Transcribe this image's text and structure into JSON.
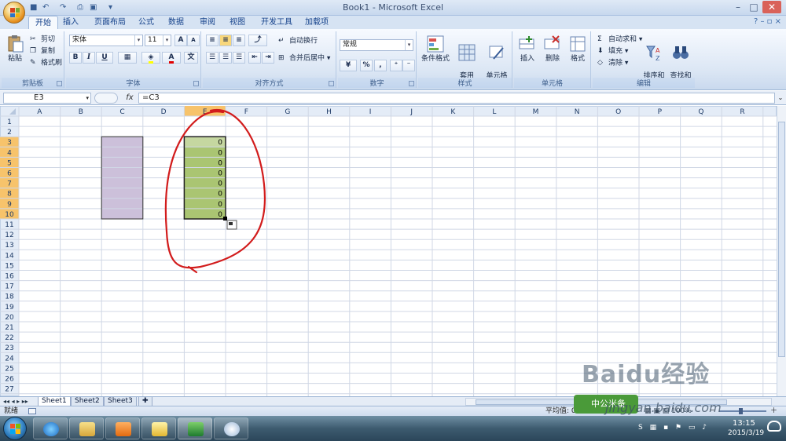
{
  "window": {
    "title": "Book1 - Microsoft Excel",
    "minimize": "–",
    "maximize": "□",
    "close": "✕"
  },
  "qat": {
    "save": "■",
    "undo": "↶",
    "redo": "↷",
    "print": "⎙",
    "preview": "▣",
    "more": "▾"
  },
  "tabs": [
    "开始",
    "插入",
    "页面布局",
    "公式",
    "数据",
    "审阅",
    "视图",
    "开发工具",
    "加载项"
  ],
  "ribbon": {
    "clipboard": {
      "label": "剪贴板",
      "paste": "粘贴",
      "cut": "剪切",
      "copy": "复制",
      "format_painter": "格式刷"
    },
    "font": {
      "label": "字体",
      "name": "宋体",
      "size": "11",
      "bold": "B",
      "italic": "I",
      "underline": "U",
      "grow": "A",
      "shrink": "A",
      "fill_label": "A"
    },
    "alignment": {
      "label": "对齐方式",
      "wrap": "自动换行",
      "merge": "合并后居中"
    },
    "number": {
      "label": "数字",
      "format": "常规",
      "percent": "%",
      "comma": ","
    },
    "styles": {
      "label": "样式",
      "conditional": "条件格式",
      "table": "套用\n表格格式",
      "cell_styles": "单元格\n样式"
    },
    "cells": {
      "label": "单元格",
      "insert": "插入",
      "delete": "删除",
      "format": "格式"
    },
    "editing": {
      "label": "编辑",
      "autosum": "自动求和",
      "fill": "填充",
      "clear": "清除",
      "sort": "排序和\n筛选",
      "find": "查找和\n选择"
    }
  },
  "formula_bar": {
    "name_box": "E3",
    "fx": "fx",
    "formula": "=C3"
  },
  "columns": [
    "A",
    "B",
    "C",
    "D",
    "E",
    "F",
    "G",
    "H",
    "I",
    "J",
    "K",
    "L",
    "M",
    "N",
    "O",
    "P",
    "Q",
    "R"
  ],
  "rows": [
    "1",
    "2",
    "3",
    "4",
    "5",
    "6",
    "7",
    "8",
    "9",
    "10",
    "11",
    "12",
    "13",
    "14",
    "15",
    "16",
    "17",
    "18",
    "19",
    "20",
    "21",
    "22",
    "23",
    "24",
    "25",
    "26",
    "27"
  ],
  "cells": {
    "E3": "0",
    "E4": "0",
    "E5": "0",
    "E6": "0",
    "E7": "0",
    "E8": "0",
    "E9": "0",
    "E10": "0"
  },
  "colors": {
    "purple_fill": "#ccc0da",
    "green_fill": "#9bbb59",
    "annotation": "#d21c1c",
    "selected_header": "#f7c36b"
  },
  "sheets": [
    "Sheet1",
    "Sheet2",
    "Sheet3"
  ],
  "sheet_nav": "◂◂ ◂ ▸ ▸▸",
  "status": {
    "ready": "就绪",
    "average": "平均值: 0",
    "views": "▦ ▣ ▤  100%",
    "zoom_minus": "－",
    "zoom_plus": "＋"
  },
  "taskbar": {
    "time": "13:15",
    "date": "2015/3/19",
    "tray": "S ▦ ▪ ⚑ ▭ ♪"
  },
  "watermark": {
    "logo": "中公米备",
    "text": "Baidu经验",
    "url": "jingyan.baidu.com"
  }
}
